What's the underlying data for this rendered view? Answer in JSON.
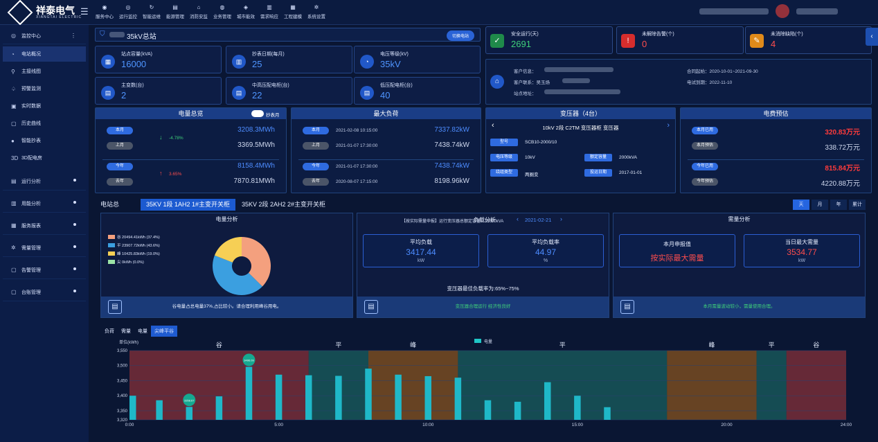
{
  "brand": {
    "name": "祥泰电气",
    "sub": "XIANGTAI ELECTRIC"
  },
  "nav": [
    {
      "icon": "◉",
      "label": "服务中心"
    },
    {
      "icon": "◎",
      "label": "运行监控"
    },
    {
      "icon": "↻",
      "label": "智能运维"
    },
    {
      "icon": "▤",
      "label": "能源管理"
    },
    {
      "icon": "⌂",
      "label": "消防安监"
    },
    {
      "icon": "◍",
      "label": "业务管理"
    },
    {
      "icon": "◈",
      "label": "城市能效"
    },
    {
      "icon": "▥",
      "label": "需求响应"
    },
    {
      "icon": "▦",
      "label": "工程建模"
    },
    {
      "icon": "✲",
      "label": "系统设置"
    }
  ],
  "sidebar": {
    "groups": [
      {
        "label": "监控中心",
        "icon": "◎"
      }
    ],
    "items": [
      {
        "label": "电站概况",
        "icon": "◔"
      },
      {
        "label": "主接线图",
        "icon": "⚲"
      },
      {
        "label": "预警监测",
        "icon": "♤"
      },
      {
        "label": "实时数据",
        "icon": "▣"
      },
      {
        "label": "历史曲线",
        "icon": "▢"
      },
      {
        "label": "智能抄表",
        "icon": "●"
      },
      {
        "label": "3D配电房",
        "icon": "3D"
      }
    ],
    "sections": [
      {
        "label": "运行分析",
        "icon": "▤"
      },
      {
        "label": "用能分析",
        "icon": "▥"
      },
      {
        "label": "服务报表",
        "icon": "▦"
      },
      {
        "label": "需量管理",
        "icon": "✲"
      },
      {
        "label": "告警管理",
        "icon": "▢"
      },
      {
        "label": "台账管理",
        "icon": "▢"
      }
    ]
  },
  "station": {
    "name": "35kV总站",
    "switch_label": "切换电站"
  },
  "cards": [
    {
      "label": "站点容量(kVA)",
      "value": "16000",
      "icon": "▦"
    },
    {
      "label": "抄表日期(每月)",
      "value": "25",
      "icon": "▥"
    },
    {
      "label": "电压等级(kV)",
      "value": "35kV",
      "icon": "◔"
    },
    {
      "label": "主变数(台)",
      "value": "2",
      "icon": "▤"
    },
    {
      "label": "中高压配电柜(台)",
      "value": "22",
      "icon": "▤"
    },
    {
      "label": "低压配电柜(台)",
      "value": "40",
      "icon": "▤"
    }
  ],
  "stats": [
    {
      "label": "安全运行(天)",
      "value": "2691",
      "color": "#3fd07a",
      "bg": "#1f8a4a",
      "icon": "✓"
    },
    {
      "label": "未解除告警(个)",
      "value": "0",
      "color": "#ff4d4d",
      "bg": "#d62d2d",
      "icon": "!"
    },
    {
      "label": "未消除缺陷(个)",
      "value": "4",
      "color": "#ff4d4d",
      "bg": "#e08a1a",
      "icon": "✎"
    }
  ],
  "customer": {
    "info_label": "客户信息：",
    "contact_label": "客户联系：",
    "contact": "吴玉炀",
    "address_label": "站点地址：",
    "contract_label": "合同起始：",
    "contract": "2020-10-01~2021-09-30",
    "test_label": "电试到期：",
    "test": "2022-11-10"
  },
  "power_total": {
    "title": "电量总览",
    "toggle_label": "抄表月",
    "rows": [
      {
        "a": "本月",
        "b": "上月",
        "va": "3208.3MWh",
        "vb": "3369.5MWh",
        "change": "-4.78%",
        "dir": "↓",
        "color": "#3fd07a"
      },
      {
        "a": "今年",
        "b": "去年",
        "va": "8158.4MWh",
        "vb": "7870.81MWh",
        "change": "3.65%",
        "dir": "↑",
        "color": "#ff4d4d"
      }
    ]
  },
  "max_load": {
    "title": "最大负荷",
    "rows": [
      {
        "a": "本月",
        "ta": "2021-02-08 10:15:00",
        "va": "7337.82kW",
        "b": "上月",
        "tb": "2021-01-07 17:30:00",
        "vb": "7438.74kW"
      },
      {
        "a": "今年",
        "ta": "2021-01-07 17:30:00",
        "va": "7438.74kW",
        "b": "去年",
        "tb": "2020-08-07 17:15:00",
        "vb": "8198.96kW"
      }
    ]
  },
  "transformer": {
    "title": "变压器（4台）",
    "name": "10kV 2段 C2TM 变压器柜 变压器",
    "fields": [
      {
        "k": "型号",
        "v": "SCB10-2000/10"
      },
      {
        "k": "电压等级",
        "v": "10kV"
      },
      {
        "k": "额定容量",
        "v": "2000kVA"
      },
      {
        "k": "绕组类型",
        "v": "两圈变"
      },
      {
        "k": "投运日期",
        "v": "2017-01-01"
      }
    ]
  },
  "fee": {
    "title": "电费预估",
    "rows": [
      {
        "a": "本月已用",
        "va": "320.83万元",
        "b": "本月预估",
        "vb": "338.72万元"
      },
      {
        "a": "今年已用",
        "va": "815.84万元",
        "b": "今年预估",
        "vb": "4220.88万元"
      }
    ]
  },
  "tabs": [
    "电站总",
    "35KV 1段 1AH2 1#主变开关柜",
    "35KV 2段 2AH2 2#主变开关柜"
  ],
  "periods": [
    "天",
    "月",
    "年",
    "累计"
  ],
  "energy": {
    "title": "电量分析",
    "legend": [
      {
        "label": "谷 20494.41kWh (37.4%)",
        "color": "#f4a07e"
      },
      {
        "label": "平 23907.72kWh (43.6%)",
        "color": "#3b9fe0"
      },
      {
        "label": "峰 10425.83kWh (19.0%)",
        "color": "#f6cf55"
      },
      {
        "label": "尖 0kWh (0.0%)",
        "color": "#9be3a6"
      }
    ],
    "foot": "谷电量占总电量37%,占比较小。请合理利用峰谷用电。"
  },
  "load": {
    "header": "【按实际需量申报】运行变压器总额定容量：16000kVA",
    "title": "负载分析",
    "date": "2021-02-21",
    "avg_load_label": "平均负载",
    "avg_load": "3417.44",
    "avg_load_unit": "kW",
    "avg_rate_label": "平均负载率",
    "avg_rate": "44.97",
    "avg_rate_unit": "%",
    "best": "变压器最佳负载率为:65%~75%",
    "foot": "变压器合理运行 经济性良好"
  },
  "demand": {
    "title": "需量分析",
    "declare_label": "本月申报值",
    "declare": "按实际最大需量",
    "max_label": "当日最大需量",
    "max": "3534.77",
    "max_unit": "kW",
    "foot": "本月需量波动较小，需量使用合理。"
  },
  "chart_tabs": [
    "负荷",
    "需量",
    "电量",
    "尖峰平谷"
  ],
  "chart_data": {
    "type": "bar",
    "ylabel": "单位(kWh)",
    "legend": "电量",
    "ylim": [
      3320,
      3550
    ],
    "yticks": [
      3320,
      3350,
      3400,
      3450,
      3500,
      3550
    ],
    "xticks": [
      "0:00",
      "5:00",
      "10:00",
      "15:00",
      "20:00",
      "24:00"
    ],
    "x": [
      0,
      1,
      2,
      3,
      4,
      5,
      6,
      7,
      8,
      9,
      10,
      11,
      12,
      13,
      14,
      15,
      16,
      17,
      18,
      19,
      20,
      21,
      22,
      23
    ],
    "values": [
      3400,
      3385,
      3363,
      3398,
      3496,
      3470,
      3468,
      3466,
      3490,
      3470,
      3465,
      3460,
      3385,
      3380,
      3445,
      3400,
      3362,
      3320,
      3320,
      3320,
      3320,
      3320,
      3320,
      3320
    ],
    "labels": [
      {
        "i": 2,
        "text": "3358.67"
      },
      {
        "i": 4,
        "text": "3496.09"
      }
    ],
    "bands": [
      {
        "from": 0,
        "to": 6,
        "name": "谷",
        "color": "#b33b3b"
      },
      {
        "from": 6,
        "to": 8,
        "name": "平",
        "color": "#1f7a6e"
      },
      {
        "from": 8,
        "to": 11,
        "name": "峰",
        "color": "#b56a16"
      },
      {
        "from": 11,
        "to": 18,
        "name": "平",
        "color": "#1f7a6e"
      },
      {
        "from": 18,
        "to": 21,
        "name": "峰",
        "color": "#b56a16"
      },
      {
        "from": 21,
        "to": 22,
        "name": "平",
        "color": "#1f7a6e"
      },
      {
        "from": 22,
        "to": 24,
        "name": "谷",
        "color": "#b33b3b"
      }
    ]
  }
}
